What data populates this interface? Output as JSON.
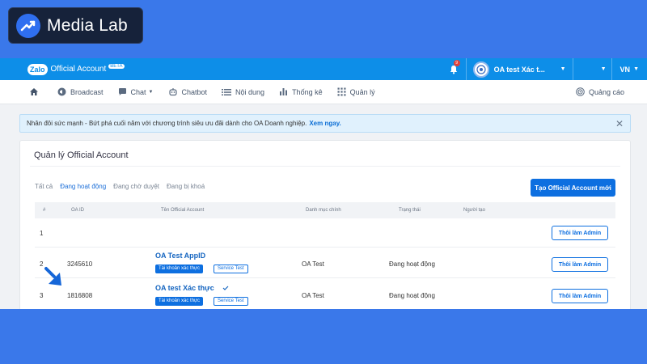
{
  "badge": {
    "label": "Media Lab"
  },
  "topbar": {
    "logo_z": "Zalo",
    "logo_text": "Official Account",
    "logo_beta": "BETA",
    "notif_count": "9",
    "account_name": "OA test Xác t...",
    "lang": "VN"
  },
  "nav": {
    "broadcast": "Broadcast",
    "chat": "Chat",
    "chatbot": "Chatbot",
    "content": "Nội dung",
    "stats": "Thống kê",
    "manage": "Quản lý",
    "ads": "Quảng cáo"
  },
  "notice": {
    "text": "Nhân đôi sức mạnh - Bứt phá cuối năm với chương trình siêu ưu đãi dành cho OA Doanh nghiệp.",
    "link": "Xem ngay."
  },
  "card": {
    "title": "Quản lý Official Account",
    "filters": [
      "Tất cả",
      "Đang hoạt động",
      "Đang chờ duyệt",
      "Đang bị khoá"
    ],
    "create_button": "Tạo Official Account mới",
    "columns": [
      "#",
      "OA ID",
      "Tên Official Account",
      "Danh mục chính",
      "Trạng thái",
      "Người tạo"
    ]
  },
  "rows": [
    {
      "num": "1",
      "id": "",
      "name": "",
      "category": "",
      "status": "",
      "tag1": "",
      "tag2": "",
      "action": "Thôi làm Admin"
    },
    {
      "num": "2",
      "id": "3245610",
      "name": "OA Test AppID",
      "category": "OA Test",
      "status": "Đang hoạt động",
      "tag1": "Tài khoản xác thực",
      "tag2": "Service Test",
      "action": "Thôi làm Admin"
    },
    {
      "num": "3",
      "id": "1816808",
      "name": "OA test Xác thực",
      "category": "OA Test",
      "status": "Đang hoạt động",
      "tag1": "Tài khoản xác thực",
      "tag2": "Service Test",
      "action": "Thôi làm Admin"
    }
  ],
  "colors": {
    "page_bg": "#3a78ea",
    "topbar": "#0d8ee8",
    "accent": "#0d6fe0"
  }
}
